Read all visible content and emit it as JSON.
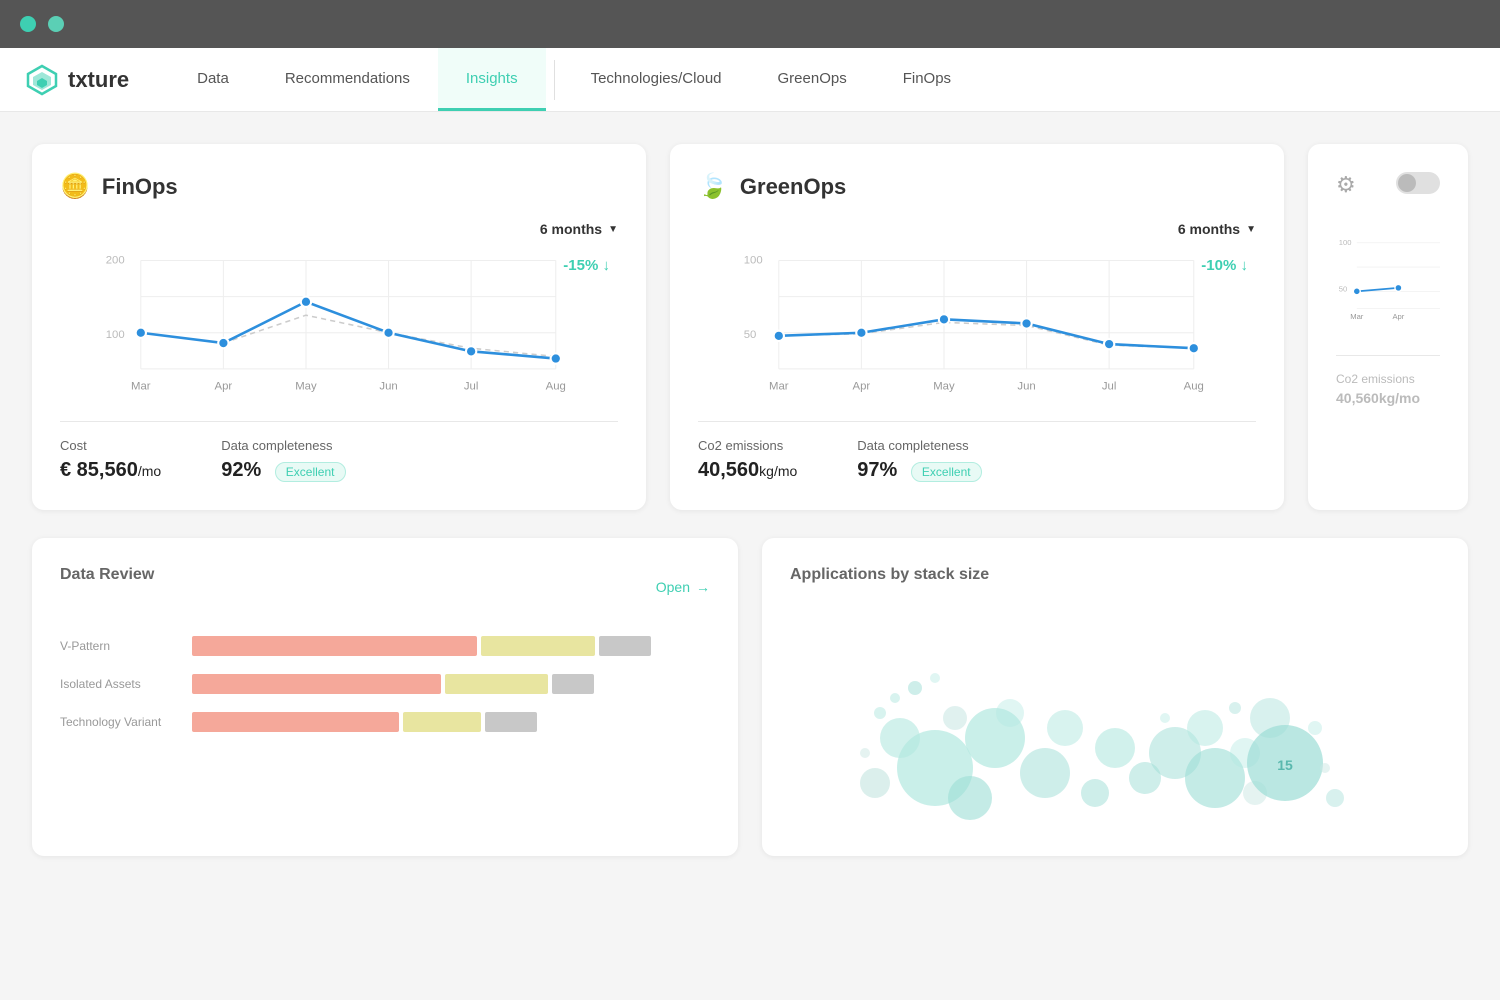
{
  "topbar": {
    "dot1": "green-dot",
    "dot2": "teal-dot"
  },
  "nav": {
    "logo_text": "txture",
    "items": [
      {
        "label": "Data",
        "active": false
      },
      {
        "label": "Recommendations",
        "active": false
      },
      {
        "label": "Insights",
        "active": true
      },
      {
        "label": "Technologies/Cloud",
        "active": false
      },
      {
        "label": "GreenOps",
        "active": false
      },
      {
        "label": "FinOps",
        "active": false
      }
    ]
  },
  "finops_card": {
    "title": "FinOps",
    "time_selector": "6 months",
    "change_label": "-15%",
    "change_arrow": "↓",
    "y_labels": [
      "200",
      "100"
    ],
    "x_labels": [
      "Mar",
      "Apr",
      "May",
      "Jun",
      "Jul",
      "Aug"
    ],
    "cost_label": "Cost",
    "cost_value": "€ 85,560",
    "cost_unit": "/mo",
    "completeness_label": "Data completeness",
    "completeness_value": "92%",
    "completeness_badge": "Excellent"
  },
  "greenops_card": {
    "title": "GreenOps",
    "time_selector": "6 months",
    "change_label": "-10%",
    "change_arrow": "↓",
    "y_labels": [
      "100",
      "50"
    ],
    "x_labels": [
      "Mar",
      "Apr",
      "May",
      "Jun",
      "Jul",
      "Aug"
    ],
    "emissions_label": "Co2 emissions",
    "emissions_value": "40,560",
    "emissions_unit": "kg/mo",
    "completeness_label": "Data completeness",
    "completeness_value": "97%",
    "completeness_badge": "Excellent"
  },
  "partial_card": {
    "y_labels": [
      "100",
      "50"
    ],
    "x_labels": [
      "Mar",
      "Apr"
    ],
    "emissions_label": "Co2 emissions",
    "emissions_value": "40,560kg/mo"
  },
  "data_review": {
    "title": "Data Review",
    "open_label": "Open",
    "open_arrow": "→",
    "bars": [
      {
        "label": "V-Pattern",
        "red": 55,
        "yellow": 22,
        "gray": 10
      },
      {
        "label": "Isolated Assets",
        "red": 48,
        "yellow": 20,
        "gray": 8
      },
      {
        "label": "Technology Variant",
        "red": 40,
        "yellow": 15,
        "gray": 10
      }
    ]
  },
  "apps_by_stack": {
    "title": "Applications by stack size"
  }
}
